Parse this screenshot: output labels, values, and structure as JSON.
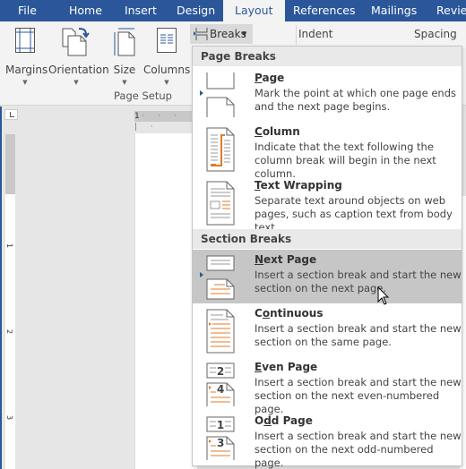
{
  "tabs": [
    {
      "label": "File",
      "active": false
    },
    {
      "label": "Home",
      "active": false
    },
    {
      "label": "Insert",
      "active": false
    },
    {
      "label": "Design",
      "active": false
    },
    {
      "label": "Layout",
      "active": true
    },
    {
      "label": "References",
      "active": false
    },
    {
      "label": "Mailings",
      "active": false
    },
    {
      "label": "Review",
      "active": false
    }
  ],
  "ribbon": {
    "margins_label": "Margins",
    "orientation_label": "Orientation",
    "size_label": "Size",
    "columns_label": "Columns",
    "group_label": "Page Setup",
    "breaks_label": "Breaks",
    "indent_label": "Indent",
    "spacing_label": "Spacing"
  },
  "ruler": {
    "horizontal_start": "1",
    "vertical_labels": [
      "1",
      "2",
      "3"
    ]
  },
  "menu": {
    "page_breaks_header": "Page Breaks",
    "section_breaks_header": "Section Breaks",
    "page_breaks": [
      {
        "access_key": "P",
        "rest": "age",
        "desc": "Mark the point at which one page ends and the next page begins.",
        "icon": "page-break-icon"
      },
      {
        "access_key": "C",
        "rest": "olumn",
        "desc": "Indicate that the text following the column break will begin in the next column.",
        "icon": "column-break-icon"
      },
      {
        "access_key": "T",
        "rest": "ext Wrapping",
        "desc": "Separate text around objects on web pages, such as caption text from body text.",
        "icon": "text-wrapping-icon"
      }
    ],
    "section_breaks": [
      {
        "pre": "",
        "access_key": "N",
        "rest": "ext Page",
        "desc": "Insert a section break and start the new section on the next page.",
        "icon": "next-page-icon",
        "hovered": true
      },
      {
        "pre": "C",
        "access_key": "o",
        "rest": "ntinuous",
        "desc": "Insert a section break and start the new section on the same page.",
        "icon": "continuous-icon",
        "hovered": false
      },
      {
        "pre": "",
        "access_key": "E",
        "rest": "ven Page",
        "desc": "Insert a section break and start the new section on the next even-numbered page.",
        "icon": "even-page-icon",
        "hovered": false,
        "numbers": [
          "2",
          "4"
        ]
      },
      {
        "pre": "O",
        "access_key": "d",
        "rest": "d Page",
        "desc": "Insert a section break and start the new section on the next odd-numbered page.",
        "icon": "odd-page-icon",
        "hovered": false,
        "numbers": [
          "1",
          "3"
        ]
      }
    ]
  },
  "colors": {
    "accent": "#2b579a",
    "orange": "#e07b2a",
    "hover": "#c6c6c6"
  }
}
